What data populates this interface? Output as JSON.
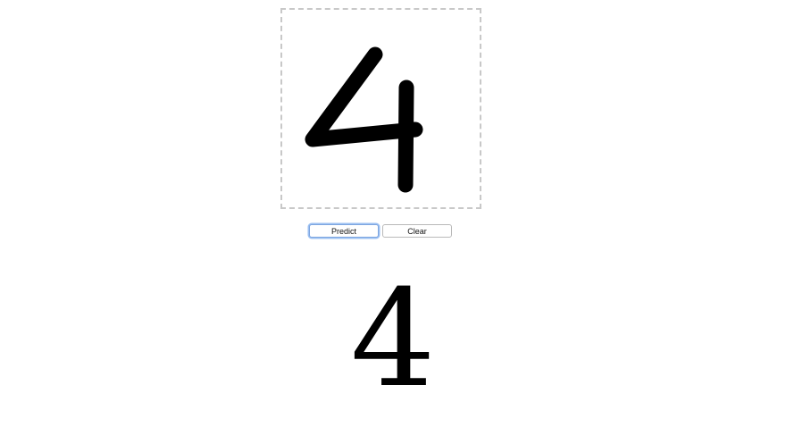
{
  "drawing_canvas": {
    "drawn_digit_icon": "handwritten-four-stroke",
    "stroke_color": "#000000",
    "border_color": "#c8c8c8"
  },
  "controls": {
    "predict_label": "Predict",
    "clear_label": "Clear",
    "focus_color": "#9cc0f2"
  },
  "result": {
    "predicted_digit": "4"
  }
}
